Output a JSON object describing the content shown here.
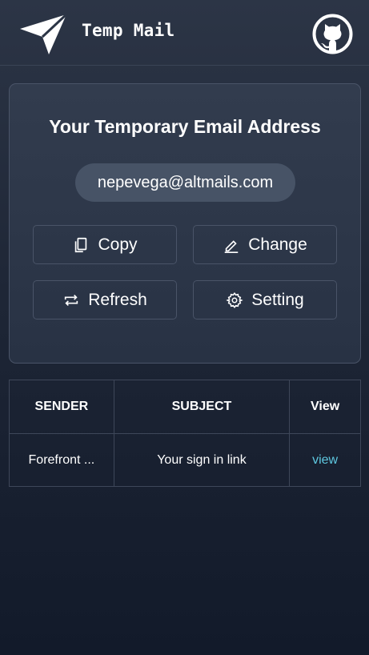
{
  "header": {
    "app_title": "Temp Mail",
    "logo_icon": "paper-plane-icon",
    "github_icon": "github-icon"
  },
  "email_card": {
    "title": "Your Temporary Email Address",
    "email": "nepevega@altmails.com",
    "buttons": {
      "copy": {
        "label": "Copy",
        "icon": "copy-icon"
      },
      "change": {
        "label": "Change",
        "icon": "pencil-icon"
      },
      "refresh": {
        "label": "Refresh",
        "icon": "refresh-icon"
      },
      "setting": {
        "label": "Setting",
        "icon": "gear-icon"
      }
    }
  },
  "inbox": {
    "columns": [
      "SENDER",
      "SUBJECT",
      "View"
    ],
    "rows": [
      {
        "sender": "Forefront ...",
        "subject": "Your sign in link",
        "action": "view"
      }
    ]
  },
  "colors": {
    "background_top": "#2c3546",
    "background_bottom": "#121a2a",
    "pill": "#475366",
    "link": "#5ec8e0",
    "border": "#4a5468"
  }
}
